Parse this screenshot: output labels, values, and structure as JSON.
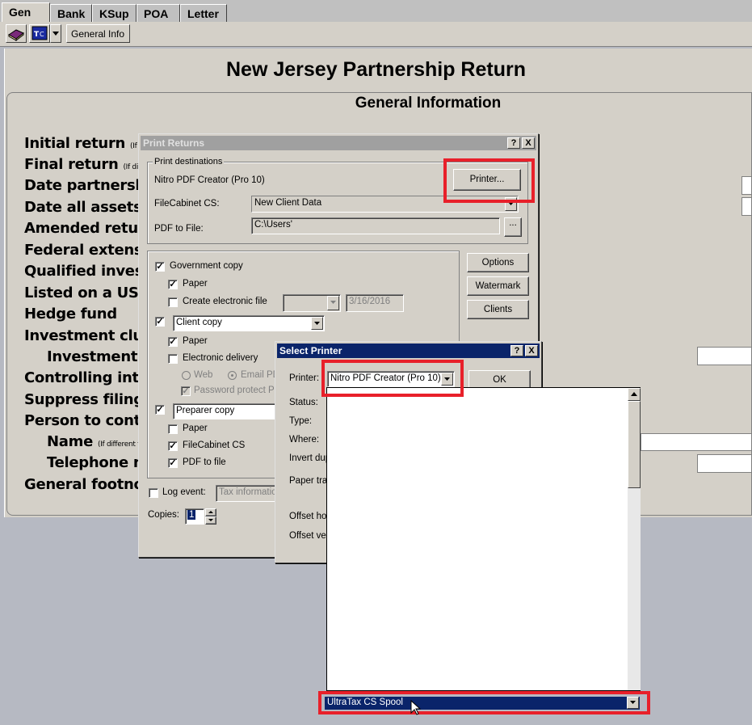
{
  "tabs": [
    "Gen",
    "Bank",
    "KSup",
    "POA",
    "Letter"
  ],
  "toolbar": {
    "general_info": "General Info"
  },
  "form": {
    "title": "New Jersey Partnership Return",
    "subtitle": "General Information",
    "labels": [
      {
        "text": "Initial return",
        "note": "(If diffe"
      },
      {
        "text": "Final return",
        "note": "(If differ"
      },
      {
        "text": "Date partnership",
        "note": ""
      },
      {
        "text": "Date all assets w",
        "note": ""
      },
      {
        "text": "Amended return",
        "note": ""
      },
      {
        "text": "Federal extensio",
        "note": ""
      },
      {
        "text": "Qualified investr",
        "note": ""
      },
      {
        "text": "Listed on a US na",
        "note": ""
      },
      {
        "text": "Hedge fund",
        "note": ""
      },
      {
        "text": "Investment club:",
        "note": ""
      },
      {
        "text": "Investment cl",
        "note": ""
      },
      {
        "text": "Controlling inter",
        "note": ""
      },
      {
        "text": "Suppress filing fe",
        "note": ""
      },
      {
        "text": "Person to contac",
        "note": ""
      },
      {
        "text": "Name",
        "note": "(If different fr"
      },
      {
        "text": "Telephone nu",
        "note": ""
      },
      {
        "text": "General footnote",
        "note": ""
      }
    ]
  },
  "print_dialog": {
    "title": "Print Returns",
    "help": "?",
    "close": "X",
    "destinations_label": "Print destinations",
    "printer_name": "Nitro PDF Creator (Pro 10)",
    "printer_button": "Printer...",
    "filecabinet_label": "FileCabinet CS:",
    "filecabinet_value": "New Client Data",
    "pdf_label": "PDF to File:",
    "pdf_value": "C:\\Users'",
    "browse": "...",
    "gov_copy": "Government copy",
    "paper": "Paper",
    "create_efile": "Create electronic file",
    "efile_date": "3/16/2016",
    "client_copy": "Client copy",
    "electronic_delivery": "Electronic delivery",
    "web": "Web",
    "email": "Email PD",
    "password_protect": "Password protect PD",
    "preparer_copy": "Preparer copy",
    "filecabinet_cs": "FileCabinet CS",
    "pdf_to_file": "PDF to file",
    "log_event": "Log event:",
    "log_value": "Tax information",
    "copies_label": "Copies:",
    "copies_value": "1",
    "options": "Options",
    "watermark": "Watermark",
    "clients": "Clients"
  },
  "select_printer": {
    "title": "Select Printer",
    "help": "?",
    "close": "X",
    "printer_label": "Printer:",
    "printer_value": "Nitro PDF Creator (Pro 10)",
    "ok": "OK",
    "status": "Status:",
    "type": "Type:",
    "where": "Where:",
    "invert": "Invert dup",
    "paper_tray": "Paper tray",
    "offset_hor": "Offset hor",
    "offset_ver": "Offset ver",
    "selected_option": "UltraTax CS Spool"
  },
  "colors": {
    "highlight": "#e8202a",
    "selection": "#0a246a"
  }
}
